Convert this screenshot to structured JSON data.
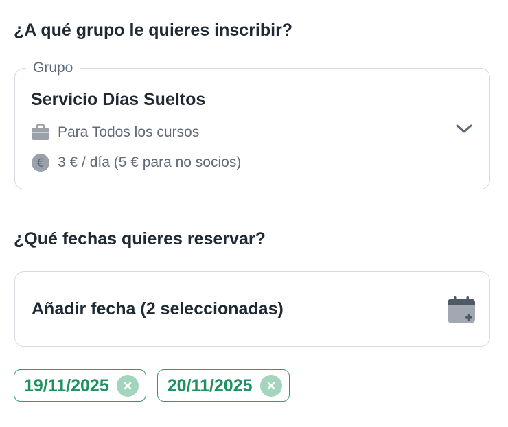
{
  "group_section": {
    "question": "¿A qué grupo le quieres inscribir?",
    "legend": "Grupo",
    "selected_group": {
      "name": "Servicio Días Sueltos",
      "courses_text": "Para Todos los cursos",
      "price_text": "3 € / día (5 € para no socios)"
    },
    "icons": {
      "courses": "briefcase-icon",
      "price": "euro-coin-icon",
      "dropdown": "chevron-down-icon"
    }
  },
  "dates_section": {
    "question": "¿Qué fechas quieres reservar?",
    "add_date_label": "Añadir fecha (2 seleccionadas)",
    "icon": "calendar-add-icon",
    "selected_dates": [
      {
        "label": "19/11/2025"
      },
      {
        "label": "20/11/2025"
      }
    ]
  },
  "colors": {
    "text_primary": "#1f2933",
    "text_secondary": "#5f6b7a",
    "border": "#d6d9dd",
    "icon_gray": "#9aa1ab",
    "chip_green": "#1e9160",
    "chip_remove_bg": "#a3d5bd"
  }
}
